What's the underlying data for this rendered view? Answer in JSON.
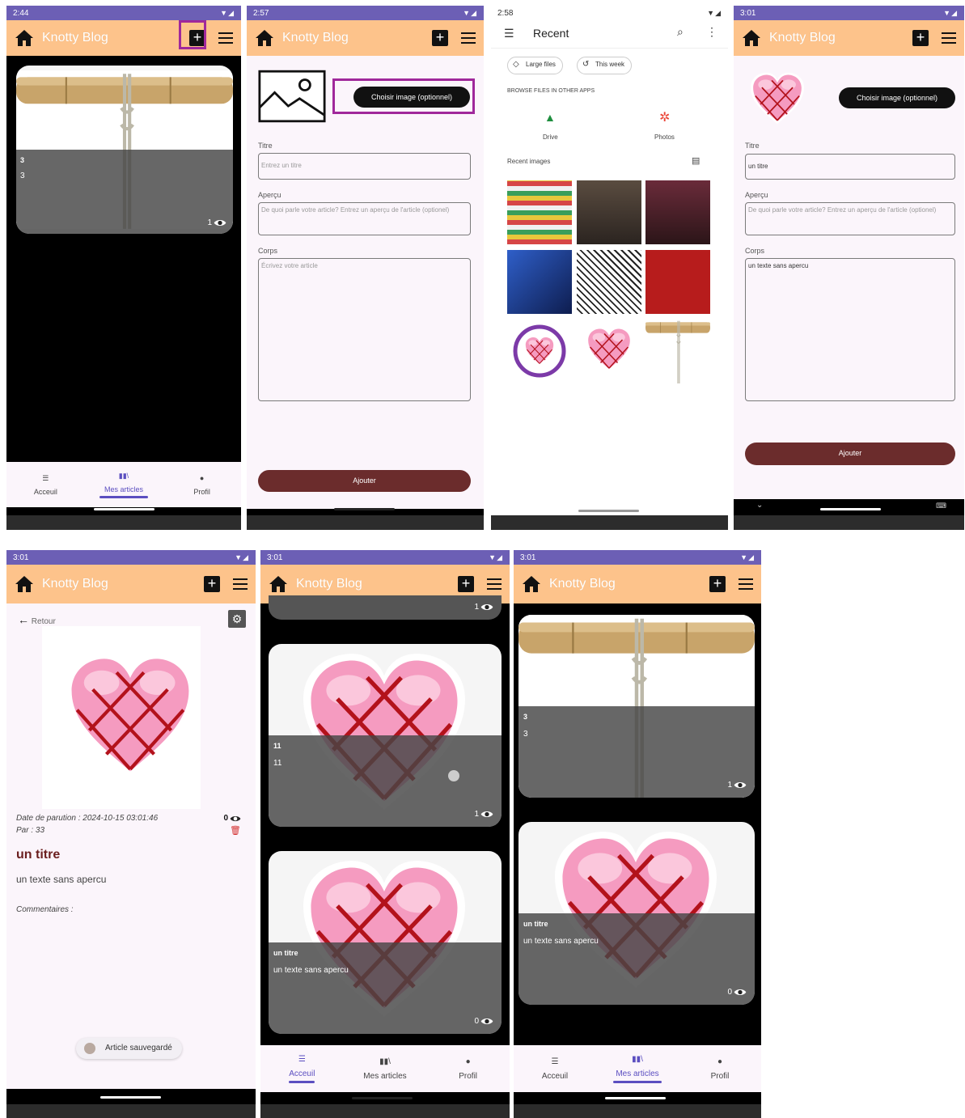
{
  "app": {
    "title": "Knotty Blog"
  },
  "screens": {
    "s1": {
      "time": "2:44",
      "card": {
        "line1": "3",
        "line2": "3",
        "views": "1"
      }
    },
    "s2": {
      "time": "2:57",
      "choose": "Choisir image (optionnel)",
      "title_label": "Titre",
      "title_ph": "Entrez un titre",
      "preview_label": "Aperçu",
      "preview_ph": "De quoi parle votre article? Entrez un aperçu de l'article (optionel)",
      "body_label": "Corps",
      "body_ph": "Écrivez votre article",
      "submit": "Ajouter"
    },
    "s3": {
      "time": "2:58",
      "header": "Recent",
      "chip1": "Large files",
      "chip2": "This week",
      "browse": "BROWSE FILES IN OTHER APPS",
      "drive": "Drive",
      "photos": "Photos",
      "recent_images": "Recent images"
    },
    "s4": {
      "time": "3:01",
      "choose": "Choisir image (optionnel)",
      "title_label": "Titre",
      "title_val": "un titre",
      "preview_label": "Aperçu",
      "preview_ph": "De quoi parle votre article? Entrez un aperçu de l'article (optionel)",
      "body_label": "Corps",
      "body_val": "un texte sans apercu",
      "submit": "Ajouter"
    },
    "s5": {
      "time": "3:01",
      "back": "Retour",
      "date": "Date de parution : 2024-10-15 03:01:46",
      "author": "Par : 33",
      "views": "0",
      "title": "un titre",
      "body": "un texte sans apercu",
      "comments": "Commentaires :",
      "toast": "Article sauvegardé"
    },
    "s6": {
      "time": "3:01",
      "top_views": "1",
      "c1_line1": "11",
      "c1_line2": "11",
      "c1_views": "1",
      "c2_title": "un titre",
      "c2_body": "un texte sans apercu",
      "c2_views": "0"
    },
    "s7": {
      "time": "3:01",
      "c1_line1": "3",
      "c1_line2": "3",
      "c1_views": "1",
      "c2_title": "un titre",
      "c2_body": "un texte sans apercu",
      "c2_views": "0"
    }
  },
  "nav": {
    "home": "Acceuil",
    "articles": "Mes articles",
    "profile": "Profil"
  }
}
